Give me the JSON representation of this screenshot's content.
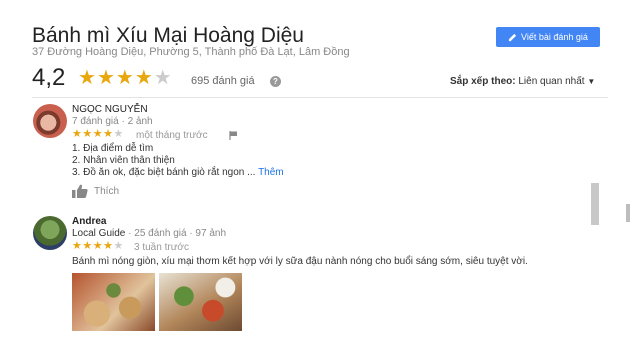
{
  "place": {
    "title": "Bánh mì Xíu Mại Hoàng Diệu",
    "address": "37 Đường Hoàng Diệu, Phường 5, Thành phố Đà Lạt, Lâm Đồng",
    "rating": "4,2",
    "rating_value": 4.2,
    "review_count": "695 đánh giá",
    "help_symbol": "?"
  },
  "actions": {
    "write_review": "Viết bài đánh giá"
  },
  "sort": {
    "label": "Sắp xếp theo:",
    "value": "Liên quan nhất"
  },
  "reviews": [
    {
      "name": "NGỌC NGUYỄN",
      "meta": "7 đánh giá · 2 ảnh",
      "stars": 4,
      "time": "một tháng trước",
      "lines": [
        "1. Địa điểm dễ tìm",
        "2. Nhân viên thân thiện",
        "3. Đồ ăn ok, đặc biệt bánh giò rắt ngon ..."
      ],
      "more": "Thêm",
      "like": "Thích"
    },
    {
      "name": "Andrea",
      "meta_guide": "Local Guide",
      "meta": "· 25 đánh giá · 97 ảnh",
      "stars": 4,
      "time": "3 tuần trước",
      "text": "Bánh mì nóng giòn, xíu mại thơm kết hợp với ly sữa đậu nành nóng cho buổi sáng sớm, siêu tuyệt vời."
    }
  ],
  "colors": {
    "star": "#e7a70d",
    "button": "#4285f4",
    "link": "#1a73e8"
  }
}
